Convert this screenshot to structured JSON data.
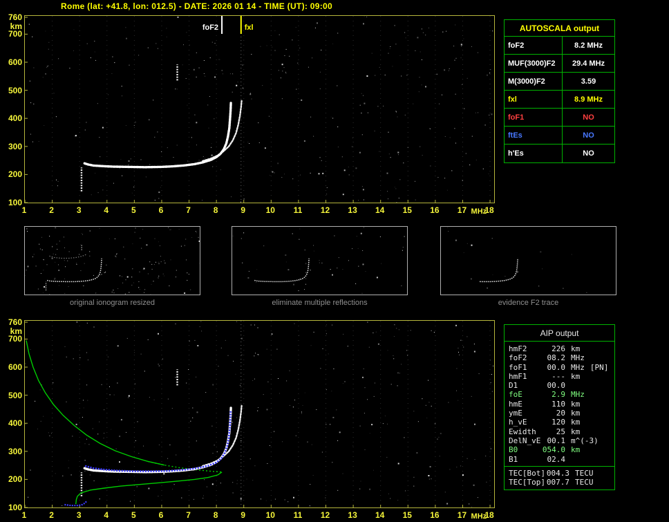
{
  "title": "Rome (lat: +41.8, lon: 012.5) - DATE: 2026 01 14 - TIME (UT): 09:00",
  "thumbnails": [
    {
      "caption": "original ionogram resized"
    },
    {
      "caption": "eliminate multiple reflections"
    },
    {
      "caption": "evidence F2 trace"
    }
  ],
  "autoscala_table": {
    "header": "AUTOSCALA output",
    "rows": [
      {
        "label": "foF2",
        "value": "8.2 MHz",
        "color": "#ffffff"
      },
      {
        "label": "MUF(3000)F2",
        "value": "29.4 MHz",
        "color": "#ffffff"
      },
      {
        "label": "M(3000)F2",
        "value": "3.59",
        "color": "#ffffff"
      },
      {
        "label": "fxl",
        "value": "8.9 MHz",
        "color": "#ffff00"
      },
      {
        "label": "foF1",
        "value": "NO",
        "color": "#ff4040"
      },
      {
        "label": "ftEs",
        "value": "NO",
        "color": "#4878ff"
      },
      {
        "label": "h'Es",
        "value": "NO",
        "color": "#ffffff"
      }
    ]
  },
  "aip_table": {
    "header": "AIP output",
    "rows": [
      {
        "name": "hmF2",
        "value": "226",
        "unit": "km",
        "note": "",
        "color": "#e8e8e8"
      },
      {
        "name": "foF2",
        "value": "08.2",
        "unit": "MHz",
        "note": "",
        "color": "#e8e8e8"
      },
      {
        "name": "foF1",
        "value": "00.0",
        "unit": "MHz",
        "note": "[PN]",
        "color": "#e8e8e8"
      },
      {
        "name": "hmF1",
        "value": "---",
        "unit": "km",
        "note": "",
        "color": "#e8e8e8"
      },
      {
        "name": "D1",
        "value": "00.0",
        "unit": "",
        "note": "",
        "color": "#e8e8e8"
      },
      {
        "name": "foE",
        "value": "2.9",
        "unit": "MHz",
        "note": "",
        "color": "#80ff80"
      },
      {
        "name": "hmE",
        "value": "110",
        "unit": "km",
        "note": "",
        "color": "#e8e8e8"
      },
      {
        "name": "ymE",
        "value": "20",
        "unit": "km",
        "note": "",
        "color": "#e8e8e8"
      },
      {
        "name": "h_vE",
        "value": "120",
        "unit": "km",
        "note": "",
        "color": "#e8e8e8"
      },
      {
        "name": "Ewidth",
        "value": "25",
        "unit": "km",
        "note": "",
        "color": "#e8e8e8"
      },
      {
        "name": "DelN_vE",
        "value": "00.1",
        "unit": "m^(-3)",
        "note": "",
        "color": "#e8e8e8"
      },
      {
        "name": "B0",
        "value": "054.0",
        "unit": "km",
        "note": "",
        "color": "#80ff80"
      },
      {
        "name": "B1",
        "value": "02.4",
        "unit": "",
        "note": "",
        "color": "#e8e8e8"
      }
    ],
    "tec_rows": [
      {
        "name": "TEC[Bot]",
        "value": "004.3",
        "unit": "TECU",
        "color": "#e8e8e8"
      },
      {
        "name": "TEC[Top]",
        "value": "007.7",
        "unit": "TECU",
        "color": "#e8e8e8"
      }
    ]
  },
  "colors": {
    "axis": "#f5f53a",
    "plot_border": "#b6b63c",
    "table_border": "#00b400",
    "trace": "#ffffff",
    "profile": "#00cc00",
    "restored": "#3c3cff",
    "marker_fof2": "#ffffff",
    "marker_fxl": "#ffff00",
    "caption": "#8f8f8f"
  },
  "chart_data": {
    "type": "scatter",
    "title": "ionogram (virtual height vs frequency)",
    "x_unit": "MHz",
    "y_unit": "km",
    "x_range": [
      1,
      18.15
    ],
    "y_range": [
      100,
      765
    ],
    "x_ticks": [
      1,
      2,
      3,
      4,
      5,
      6,
      7,
      8,
      9,
      10,
      11,
      12,
      13,
      14,
      15,
      16,
      17,
      18
    ],
    "y_ticks": [
      760,
      700,
      600,
      500,
      400,
      300,
      200,
      100
    ],
    "markers": {
      "foF2": {
        "label": "foF2",
        "freq": 8.2
      },
      "fxl": {
        "label": "fxl",
        "freq": 8.9
      }
    },
    "o_trace": [
      [
        3.18,
        240
      ],
      [
        3.3,
        236
      ],
      [
        3.5,
        232
      ],
      [
        3.8,
        230
      ],
      [
        4.2,
        228
      ],
      [
        4.8,
        227
      ],
      [
        5.4,
        226
      ],
      [
        6.0,
        227
      ],
      [
        6.4,
        229
      ],
      [
        6.8,
        232
      ],
      [
        7.2,
        237
      ],
      [
        7.5,
        243
      ],
      [
        7.8,
        252
      ],
      [
        8.0,
        262
      ],
      [
        8.15,
        274
      ],
      [
        8.27,
        290
      ],
      [
        8.36,
        310
      ],
      [
        8.42,
        335
      ],
      [
        8.47,
        365
      ],
      [
        8.5,
        400
      ],
      [
        8.52,
        430
      ],
      [
        8.53,
        455
      ]
    ],
    "x_trace": [
      [
        7.5,
        248
      ],
      [
        7.8,
        257
      ],
      [
        8.05,
        268
      ],
      [
        8.25,
        282
      ],
      [
        8.45,
        300
      ],
      [
        8.6,
        322
      ],
      [
        8.72,
        348
      ],
      [
        8.8,
        378
      ],
      [
        8.86,
        410
      ],
      [
        8.9,
        440
      ],
      [
        8.92,
        462
      ]
    ],
    "second_hop": [
      [
        3.4,
        478
      ],
      [
        3.9,
        463
      ],
      [
        4.6,
        456
      ],
      [
        5.3,
        456
      ],
      [
        6.0,
        463
      ],
      [
        6.6,
        476
      ],
      [
        7.0,
        492
      ]
    ],
    "profile_topside": [
      [
        1.05,
        695
      ],
      [
        1.15,
        648
      ],
      [
        1.3,
        600
      ],
      [
        1.5,
        552
      ],
      [
        1.75,
        508
      ],
      [
        2.05,
        466
      ],
      [
        2.4,
        428
      ],
      [
        2.8,
        392
      ],
      [
        3.25,
        358
      ],
      [
        3.75,
        328
      ],
      [
        4.3,
        302
      ],
      [
        4.9,
        281
      ],
      [
        5.5,
        264
      ],
      [
        6.1,
        251
      ],
      [
        6.7,
        241
      ],
      [
        7.3,
        234
      ],
      [
        7.8,
        229
      ],
      [
        8.1,
        227
      ],
      [
        8.2,
        226
      ]
    ],
    "profile_bottomside": [
      [
        8.2,
        226
      ],
      [
        8.05,
        216
      ],
      [
        7.7,
        207
      ],
      [
        7.2,
        200
      ],
      [
        6.6,
        194
      ],
      [
        5.9,
        188
      ],
      [
        5.2,
        182
      ],
      [
        4.5,
        176
      ],
      [
        3.9,
        169
      ],
      [
        3.4,
        162
      ],
      [
        3.05,
        152
      ],
      [
        2.92,
        140
      ],
      [
        2.88,
        128
      ],
      [
        2.87,
        118
      ],
      [
        2.86,
        112
      ]
    ],
    "restored_f2": [
      [
        3.2,
        248
      ],
      [
        3.5,
        240
      ],
      [
        3.9,
        235
      ],
      [
        4.4,
        231
      ],
      [
        5.0,
        229
      ],
      [
        5.6,
        229
      ],
      [
        6.2,
        230
      ],
      [
        6.8,
        234
      ],
      [
        7.3,
        240
      ],
      [
        7.7,
        249
      ],
      [
        8.0,
        260
      ],
      [
        8.18,
        275
      ],
      [
        8.3,
        294
      ],
      [
        8.39,
        318
      ],
      [
        8.45,
        348
      ],
      [
        8.49,
        385
      ],
      [
        8.51,
        420
      ],
      [
        8.52,
        445
      ]
    ],
    "restored_e": [
      [
        2.45,
        110
      ],
      [
        2.7,
        107
      ],
      [
        2.95,
        107
      ],
      [
        3.1,
        110
      ],
      [
        3.2,
        116
      ],
      [
        3.25,
        122
      ]
    ],
    "artifacts": [
      {
        "f": 3.07,
        "h1": 140,
        "h2": 225
      },
      {
        "f": 6.57,
        "h1": 535,
        "h2": 592
      }
    ]
  }
}
